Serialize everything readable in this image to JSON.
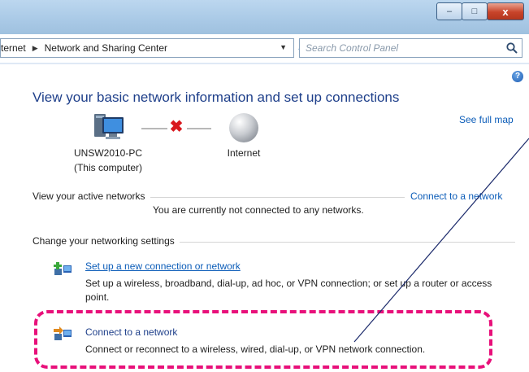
{
  "window": {
    "minimize_glyph": "–",
    "maximize_glyph": "□",
    "close_glyph": "x"
  },
  "address": {
    "crumb_1": "ternet",
    "crumb_2": "Network and Sharing Center",
    "search_placeholder": "Search Control Panel"
  },
  "main": {
    "title": "View your basic network information and set up connections",
    "see_full_map": "See full map",
    "map": {
      "computer_name": "UNSW2010-PC",
      "computer_sublabel": "(This computer)",
      "internet_label": "Internet",
      "link_status_icon": "red-x-icon"
    },
    "active_networks": {
      "label": "View your active networks",
      "connect_link": "Connect to a network",
      "status": "You are currently not connected to any networks."
    },
    "settings": {
      "label": "Change your networking settings",
      "tasks": [
        {
          "title": "Set up a new connection or network",
          "desc": "Set up a wireless, broadband, dial-up, ad hoc, or VPN connection; or set up a router or access point.",
          "icon": "new-connection-icon"
        },
        {
          "title": "Connect to a network",
          "desc": "Connect or reconnect to a wireless, wired, dial-up, or VPN network connection.",
          "icon": "connect-network-icon"
        }
      ]
    }
  },
  "colors": {
    "link": "#0b5cb8",
    "title": "#1e3f8a",
    "highlight": "#e8107a",
    "error_x": "#d9181e"
  }
}
